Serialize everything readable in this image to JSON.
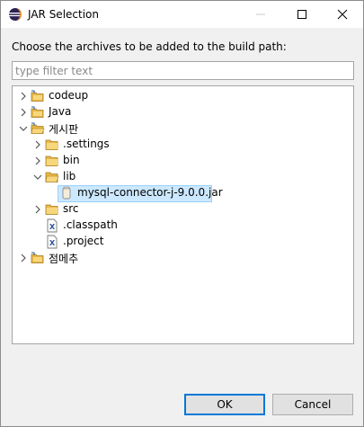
{
  "window": {
    "title": "JAR Selection",
    "icon": "eclipse-icon"
  },
  "instruction": "Choose the archives to be added to the build path:",
  "filter": {
    "value": "",
    "placeholder": "type filter text"
  },
  "tree": [
    {
      "label": "codeup",
      "type": "project",
      "expanded": false
    },
    {
      "label": "Java",
      "type": "project",
      "expanded": false
    },
    {
      "label": "게시판",
      "type": "project",
      "expanded": true
    },
    {
      "label": ".settings",
      "type": "folder",
      "expanded": false
    },
    {
      "label": "bin",
      "type": "folder",
      "expanded": false
    },
    {
      "label": "lib",
      "type": "folder",
      "expanded": true
    },
    {
      "label": "mysql-connector-j-9.0.0.jar",
      "type": "jar",
      "selected": true
    },
    {
      "label": "src",
      "type": "folder",
      "expanded": false
    },
    {
      "label": ".classpath",
      "type": "xml-file"
    },
    {
      "label": ".project",
      "type": "xml-file"
    },
    {
      "label": "점메추",
      "type": "project",
      "expanded": false
    }
  ],
  "buttons": {
    "ok": "OK",
    "cancel": "Cancel"
  },
  "colors": {
    "selection": "#cce8ff",
    "default_button_border": "#0078d7",
    "folder": "#e8b849"
  }
}
